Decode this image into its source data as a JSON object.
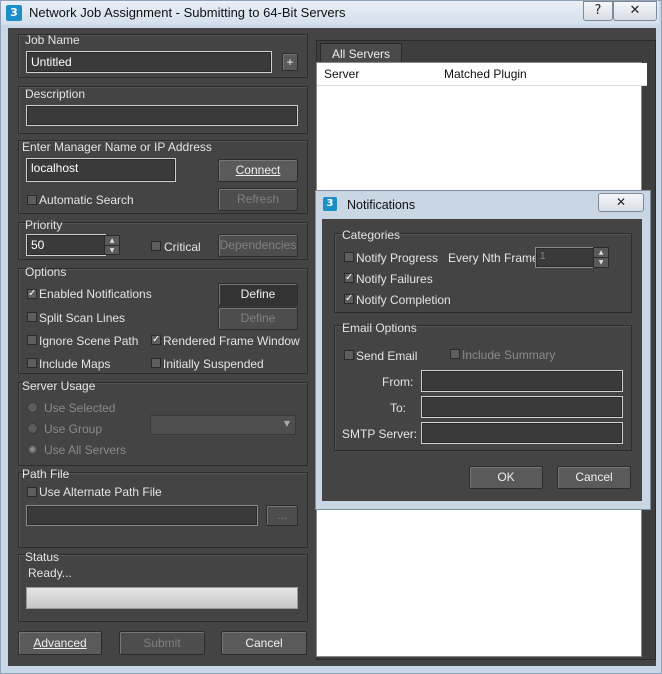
{
  "window": {
    "title": "Network Job Assignment - Submitting to 64-Bit Servers",
    "app_icon": "3",
    "help_glyph": "?",
    "close_glyph": "✕"
  },
  "job_name": {
    "label": "Job Name",
    "value": "Untitled",
    "add_label": "+"
  },
  "description": {
    "label": "Description",
    "value": ""
  },
  "manager": {
    "label": "Enter Manager Name or IP Address",
    "value": "localhost",
    "connect_label": "Connect",
    "auto_search_label": "Automatic Search",
    "refresh_label": "Refresh"
  },
  "priority": {
    "label": "Priority",
    "value": "50",
    "critical_label": "Critical",
    "dependencies_label": "Dependencies"
  },
  "options": {
    "label": "Options",
    "enabled_notifications": "Enabled Notifications",
    "define_label": "Define",
    "split_scan_lines": "Split Scan Lines",
    "define2_label": "Define",
    "ignore_scene_path": "Ignore Scene Path",
    "rendered_frame_window": "Rendered Frame Window",
    "include_maps": "Include Maps",
    "initially_suspended": "Initially Suspended"
  },
  "server_usage": {
    "label": "Server Usage",
    "use_selected": "Use Selected",
    "use_group": "Use Group",
    "use_all_servers": "Use All Servers"
  },
  "path_file": {
    "label": "Path File",
    "use_alternate": "Use Alternate Path File",
    "value": "",
    "browse_label": "..."
  },
  "status": {
    "label": "Status",
    "text": "Ready...",
    "progress": 0
  },
  "footer": {
    "advanced_label": "Advanced",
    "submit_label": "Submit",
    "cancel_label": "Cancel"
  },
  "servers_tab": {
    "tab_label": "All Servers",
    "columns": [
      "Server",
      "Matched Plugin"
    ]
  },
  "notifications": {
    "title": "Notifications",
    "close_glyph": "✕",
    "categories_label": "Categories",
    "notify_progress": "Notify Progress",
    "every_nth_label": "Every Nth Frame:",
    "every_nth_value": "1",
    "notify_failures": "Notify Failures",
    "notify_completion": "Notify Completion",
    "email_options_label": "Email Options",
    "send_email": "Send Email",
    "include_summary": "Include Summary",
    "from_label": "From:",
    "to_label": "To:",
    "smtp_label": "SMTP Server:",
    "ok_label": "OK",
    "cancel_label": "Cancel"
  }
}
